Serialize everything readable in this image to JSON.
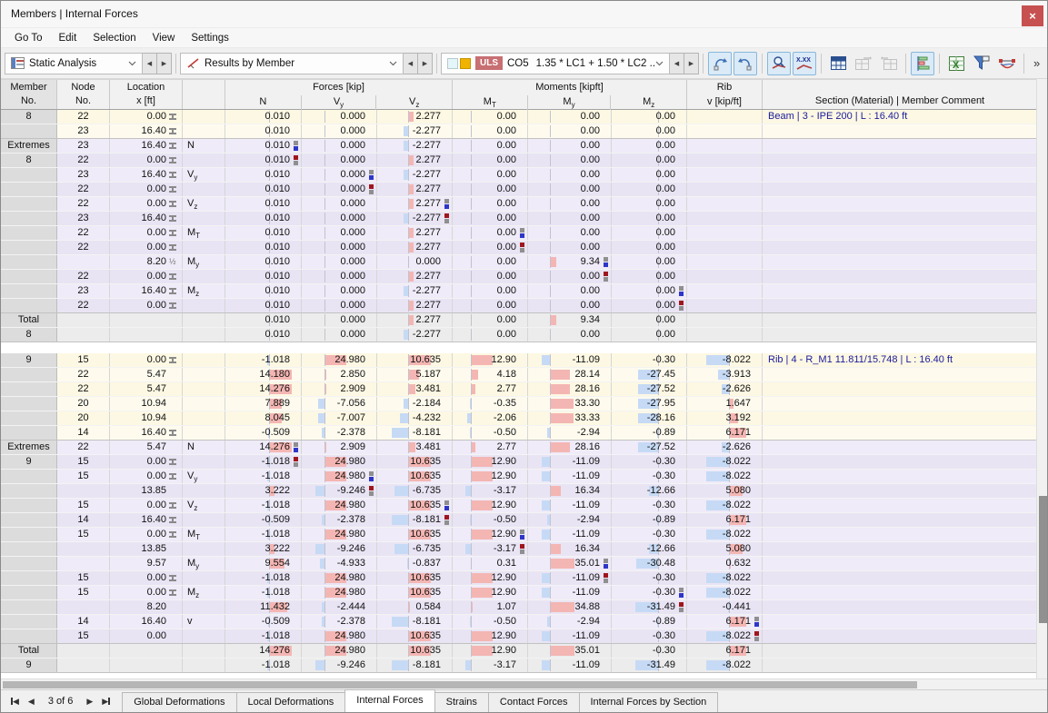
{
  "window": {
    "title": "Members | Internal Forces"
  },
  "menu": {
    "items": [
      "Go To",
      "Edit",
      "Selection",
      "View",
      "Settings"
    ]
  },
  "toolbar": {
    "analysis_label": "Static Analysis",
    "results_label": "Results by Member",
    "uls_badge": "ULS",
    "co_label": "CO5",
    "combo_value": "1.35 * LC1 + 1.50 * LC2 ...",
    "overflow": "»"
  },
  "colors": {
    "uls_bg": "#c76f73",
    "bar_positive": "#f4b6b3",
    "bar_negative": "#c6daf5",
    "max_marker_blue": "#2e36c8",
    "min_marker_red": "#9e161d",
    "marker_gray": "#8f8f8f",
    "section_text": "#1b1b9c"
  },
  "table": {
    "header": {
      "member_l1": "Member",
      "member_l2": "No.",
      "node_l1": "Node",
      "node_l2": "No.",
      "loc_l1": "Location",
      "loc_l2": "x [ft]",
      "forces_group": "Forces [kip]",
      "moments_group": "Moments [kipft]",
      "rib_group": "Rib",
      "rib_sub": "v [kip/ft]",
      "section": "Section (Material) | Member Comment",
      "subs": [
        "N",
        "Vy",
        "Vz",
        "MT",
        "My",
        "Mz"
      ]
    },
    "rows": [
      {
        "g": "8",
        "bg": "y",
        "node": "22",
        "loc": "0.00",
        "sym": "n",
        "ext": "",
        "vals": [
          "0.010",
          "0.000",
          "2.277",
          "0.00",
          "0.00",
          "0.00",
          ""
        ],
        "mk": null,
        "sec": "Beam | 3 - IPE 200 | L : 16.40 ft"
      },
      {
        "g": "",
        "bg": "y",
        "node": "23",
        "loc": "16.40",
        "sym": "n",
        "ext": "",
        "vals": [
          "0.010",
          "0.000",
          "-2.277",
          "0.00",
          "0.00",
          "0.00",
          ""
        ],
        "mk": null,
        "sec": ""
      },
      {
        "g": "Extremes",
        "bg": "e",
        "node": "23",
        "loc": "16.40",
        "sym": "n",
        "ext": "N",
        "vals": [
          "0.010",
          "0.000",
          "-2.277",
          "0.00",
          "0.00",
          "0.00",
          ""
        ],
        "mk": {
          "0": "max"
        },
        "sec": ""
      },
      {
        "g": "8",
        "bg": "e",
        "node": "22",
        "loc": "0.00",
        "sym": "n",
        "ext": "",
        "vals": [
          "0.010",
          "0.000",
          "2.277",
          "0.00",
          "0.00",
          "0.00",
          ""
        ],
        "mk": {
          "0": "min"
        },
        "sec": ""
      },
      {
        "g": "",
        "bg": "e",
        "node": "23",
        "loc": "16.40",
        "sym": "n",
        "ext": "Vy",
        "vals": [
          "0.010",
          "0.000",
          "-2.277",
          "0.00",
          "0.00",
          "0.00",
          ""
        ],
        "mk": {
          "1": "max"
        },
        "sec": ""
      },
      {
        "g": "",
        "bg": "e",
        "node": "22",
        "loc": "0.00",
        "sym": "n",
        "ext": "",
        "vals": [
          "0.010",
          "0.000",
          "2.277",
          "0.00",
          "0.00",
          "0.00",
          ""
        ],
        "mk": {
          "1": "min"
        },
        "sec": ""
      },
      {
        "g": "",
        "bg": "e",
        "node": "22",
        "loc": "0.00",
        "sym": "n",
        "ext": "Vz",
        "vals": [
          "0.010",
          "0.000",
          "2.277",
          "0.00",
          "0.00",
          "0.00",
          ""
        ],
        "mk": {
          "2": "max"
        },
        "sec": ""
      },
      {
        "g": "",
        "bg": "e",
        "node": "23",
        "loc": "16.40",
        "sym": "n",
        "ext": "",
        "vals": [
          "0.010",
          "0.000",
          "-2.277",
          "0.00",
          "0.00",
          "0.00",
          ""
        ],
        "mk": {
          "2": "min"
        },
        "sec": ""
      },
      {
        "g": "",
        "bg": "e",
        "node": "22",
        "loc": "0.00",
        "sym": "n",
        "ext": "MT",
        "vals": [
          "0.010",
          "0.000",
          "2.277",
          "0.00",
          "0.00",
          "0.00",
          ""
        ],
        "mk": {
          "3": "max"
        },
        "sec": ""
      },
      {
        "g": "",
        "bg": "e",
        "node": "22",
        "loc": "0.00",
        "sym": "n",
        "ext": "",
        "vals": [
          "0.010",
          "0.000",
          "2.277",
          "0.00",
          "0.00",
          "0.00",
          ""
        ],
        "mk": {
          "3": "min"
        },
        "sec": ""
      },
      {
        "g": "",
        "bg": "e",
        "node": "",
        "loc": "8.20",
        "sym": "h",
        "ext": "My",
        "vals": [
          "0.010",
          "0.000",
          "0.000",
          "0.00",
          "9.34",
          "0.00",
          ""
        ],
        "mk": {
          "4": "max"
        },
        "sec": ""
      },
      {
        "g": "",
        "bg": "e",
        "node": "22",
        "loc": "0.00",
        "sym": "n",
        "ext": "",
        "vals": [
          "0.010",
          "0.000",
          "2.277",
          "0.00",
          "0.00",
          "0.00",
          ""
        ],
        "mk": {
          "4": "min"
        },
        "sec": ""
      },
      {
        "g": "",
        "bg": "e",
        "node": "23",
        "loc": "16.40",
        "sym": "n",
        "ext": "Mz",
        "vals": [
          "0.010",
          "0.000",
          "-2.277",
          "0.00",
          "0.00",
          "0.00",
          ""
        ],
        "mk": {
          "5": "max"
        },
        "sec": ""
      },
      {
        "g": "",
        "bg": "e",
        "node": "22",
        "loc": "0.00",
        "sym": "n",
        "ext": "",
        "vals": [
          "0.010",
          "0.000",
          "2.277",
          "0.00",
          "0.00",
          "0.00",
          ""
        ],
        "mk": {
          "5": "min"
        },
        "sec": ""
      },
      {
        "g": "Total",
        "bg": "t",
        "node": "",
        "loc": "",
        "sym": "",
        "ext": "",
        "vals": [
          "0.010",
          "0.000",
          "2.277",
          "0.00",
          "9.34",
          "0.00",
          ""
        ],
        "mk": null,
        "sec": ""
      },
      {
        "g": "8",
        "bg": "t",
        "node": "",
        "loc": "",
        "sym": "",
        "ext": "",
        "vals": [
          "0.010",
          "0.000",
          "-2.277",
          "0.00",
          "0.00",
          "0.00",
          ""
        ],
        "mk": null,
        "sec": ""
      },
      {
        "bg": "sp"
      },
      {
        "g": "9",
        "bg": "y",
        "node": "15",
        "loc": "0.00",
        "sym": "n",
        "ext": "",
        "vals": [
          "-1.018",
          "24.980",
          "10.635",
          "12.90",
          "-11.09",
          "-0.30",
          "-8.022"
        ],
        "mk": null,
        "sec": "Rib | 4 - R_M1 11.811/15.748 | L : 16.40 ft"
      },
      {
        "g": "",
        "bg": "y",
        "node": "22",
        "loc": "5.47",
        "sym": "",
        "ext": "",
        "vals": [
          "14.180",
          "2.850",
          "5.187",
          "4.18",
          "28.14",
          "-27.45",
          "-3.913"
        ],
        "mk": null,
        "sec": ""
      },
      {
        "g": "",
        "bg": "y",
        "node": "22",
        "loc": "5.47",
        "sym": "",
        "ext": "",
        "vals": [
          "14.276",
          "2.909",
          "3.481",
          "2.77",
          "28.16",
          "-27.52",
          "-2.626"
        ],
        "mk": null,
        "sec": ""
      },
      {
        "g": "",
        "bg": "y",
        "node": "20",
        "loc": "10.94",
        "sym": "",
        "ext": "",
        "vals": [
          "7.889",
          "-7.056",
          "-2.184",
          "-0.35",
          "33.30",
          "-27.95",
          "1.647"
        ],
        "mk": null,
        "sec": ""
      },
      {
        "g": "",
        "bg": "y",
        "node": "20",
        "loc": "10.94",
        "sym": "",
        "ext": "",
        "vals": [
          "8.045",
          "-7.007",
          "-4.232",
          "-2.06",
          "33.33",
          "-28.16",
          "3.192"
        ],
        "mk": null,
        "sec": ""
      },
      {
        "g": "",
        "bg": "y",
        "node": "14",
        "loc": "16.40",
        "sym": "n",
        "ext": "",
        "vals": [
          "-0.509",
          "-2.378",
          "-8.181",
          "-0.50",
          "-2.94",
          "-0.89",
          "6.171"
        ],
        "mk": null,
        "sec": ""
      },
      {
        "g": "Extremes",
        "bg": "e",
        "node": "22",
        "loc": "5.47",
        "sym": "",
        "ext": "N",
        "vals": [
          "14.276",
          "2.909",
          "3.481",
          "2.77",
          "28.16",
          "-27.52",
          "-2.626"
        ],
        "mk": {
          "0": "max"
        },
        "sec": ""
      },
      {
        "g": "9",
        "bg": "e",
        "node": "15",
        "loc": "0.00",
        "sym": "n",
        "ext": "",
        "vals": [
          "-1.018",
          "24.980",
          "10.635",
          "12.90",
          "-11.09",
          "-0.30",
          "-8.022"
        ],
        "mk": {
          "0": "min"
        },
        "sec": ""
      },
      {
        "g": "",
        "bg": "e",
        "node": "15",
        "loc": "0.00",
        "sym": "n",
        "ext": "Vy",
        "vals": [
          "-1.018",
          "24.980",
          "10.635",
          "12.90",
          "-11.09",
          "-0.30",
          "-8.022"
        ],
        "mk": {
          "1": "max"
        },
        "sec": ""
      },
      {
        "g": "",
        "bg": "e",
        "node": "",
        "loc": "13.85",
        "sym": "",
        "ext": "",
        "vals": [
          "3.222",
          "-9.246",
          "-6.735",
          "-3.17",
          "16.34",
          "-12.66",
          "5.080"
        ],
        "mk": {
          "1": "min"
        },
        "sec": ""
      },
      {
        "g": "",
        "bg": "e",
        "node": "15",
        "loc": "0.00",
        "sym": "n",
        "ext": "Vz",
        "vals": [
          "-1.018",
          "24.980",
          "10.635",
          "12.90",
          "-11.09",
          "-0.30",
          "-8.022"
        ],
        "mk": {
          "2": "max"
        },
        "sec": ""
      },
      {
        "g": "",
        "bg": "e",
        "node": "14",
        "loc": "16.40",
        "sym": "n",
        "ext": "",
        "vals": [
          "-0.509",
          "-2.378",
          "-8.181",
          "-0.50",
          "-2.94",
          "-0.89",
          "6.171"
        ],
        "mk": {
          "2": "min"
        },
        "sec": ""
      },
      {
        "g": "",
        "bg": "e",
        "node": "15",
        "loc": "0.00",
        "sym": "n",
        "ext": "MT",
        "vals": [
          "-1.018",
          "24.980",
          "10.635",
          "12.90",
          "-11.09",
          "-0.30",
          "-8.022"
        ],
        "mk": {
          "3": "max"
        },
        "sec": ""
      },
      {
        "g": "",
        "bg": "e",
        "node": "",
        "loc": "13.85",
        "sym": "",
        "ext": "",
        "vals": [
          "3.222",
          "-9.246",
          "-6.735",
          "-3.17",
          "16.34",
          "-12.66",
          "5.080"
        ],
        "mk": {
          "3": "min"
        },
        "sec": ""
      },
      {
        "g": "",
        "bg": "e",
        "node": "",
        "loc": "9.57",
        "sym": "",
        "ext": "My",
        "vals": [
          "9.554",
          "-4.933",
          "-0.837",
          "0.31",
          "35.01",
          "-30.48",
          "0.632"
        ],
        "mk": {
          "4": "max"
        },
        "sec": ""
      },
      {
        "g": "",
        "bg": "e",
        "node": "15",
        "loc": "0.00",
        "sym": "n",
        "ext": "",
        "vals": [
          "-1.018",
          "24.980",
          "10.635",
          "12.90",
          "-11.09",
          "-0.30",
          "-8.022"
        ],
        "mk": {
          "4": "min"
        },
        "sec": ""
      },
      {
        "g": "",
        "bg": "e",
        "node": "15",
        "loc": "0.00",
        "sym": "n",
        "ext": "Mz",
        "vals": [
          "-1.018",
          "24.980",
          "10.635",
          "12.90",
          "-11.09",
          "-0.30",
          "-8.022"
        ],
        "mk": {
          "5": "max"
        },
        "sec": ""
      },
      {
        "g": "",
        "bg": "e",
        "node": "",
        "loc": "8.20",
        "sym": "",
        "ext": "",
        "vals": [
          "11.432",
          "-2.444",
          "0.584",
          "1.07",
          "34.88",
          "-31.49",
          "-0.441"
        ],
        "mk": {
          "5": "min"
        },
        "sec": ""
      },
      {
        "g": "",
        "bg": "e",
        "node": "14",
        "loc": "16.40",
        "sym": "",
        "ext": "v",
        "vals": [
          "-0.509",
          "-2.378",
          "-8.181",
          "-0.50",
          "-2.94",
          "-0.89",
          "6.171"
        ],
        "mk": {
          "6": "max"
        },
        "sec": ""
      },
      {
        "g": "",
        "bg": "e",
        "node": "15",
        "loc": "0.00",
        "sym": "",
        "ext": "",
        "vals": [
          "-1.018",
          "24.980",
          "10.635",
          "12.90",
          "-11.09",
          "-0.30",
          "-8.022"
        ],
        "mk": {
          "6": "min"
        },
        "sec": ""
      },
      {
        "g": "Total",
        "bg": "t",
        "node": "",
        "loc": "",
        "sym": "",
        "ext": "",
        "vals": [
          "14.276",
          "24.980",
          "10.635",
          "12.90",
          "35.01",
          "-0.30",
          "6.171"
        ],
        "mk": null,
        "sec": ""
      },
      {
        "g": "9",
        "bg": "t",
        "node": "",
        "loc": "",
        "sym": "",
        "ext": "",
        "vals": [
          "-1.018",
          "-9.246",
          "-8.181",
          "-3.17",
          "-11.09",
          "-31.49",
          "-8.022"
        ],
        "mk": null,
        "sec": ""
      }
    ]
  },
  "statusbar": {
    "page": "3 of 6",
    "tabs": [
      "Global Deformations",
      "Local Deformations",
      "Internal Forces",
      "Strains",
      "Contact Forces",
      "Internal Forces by Section"
    ],
    "active_tab": "Internal Forces"
  }
}
